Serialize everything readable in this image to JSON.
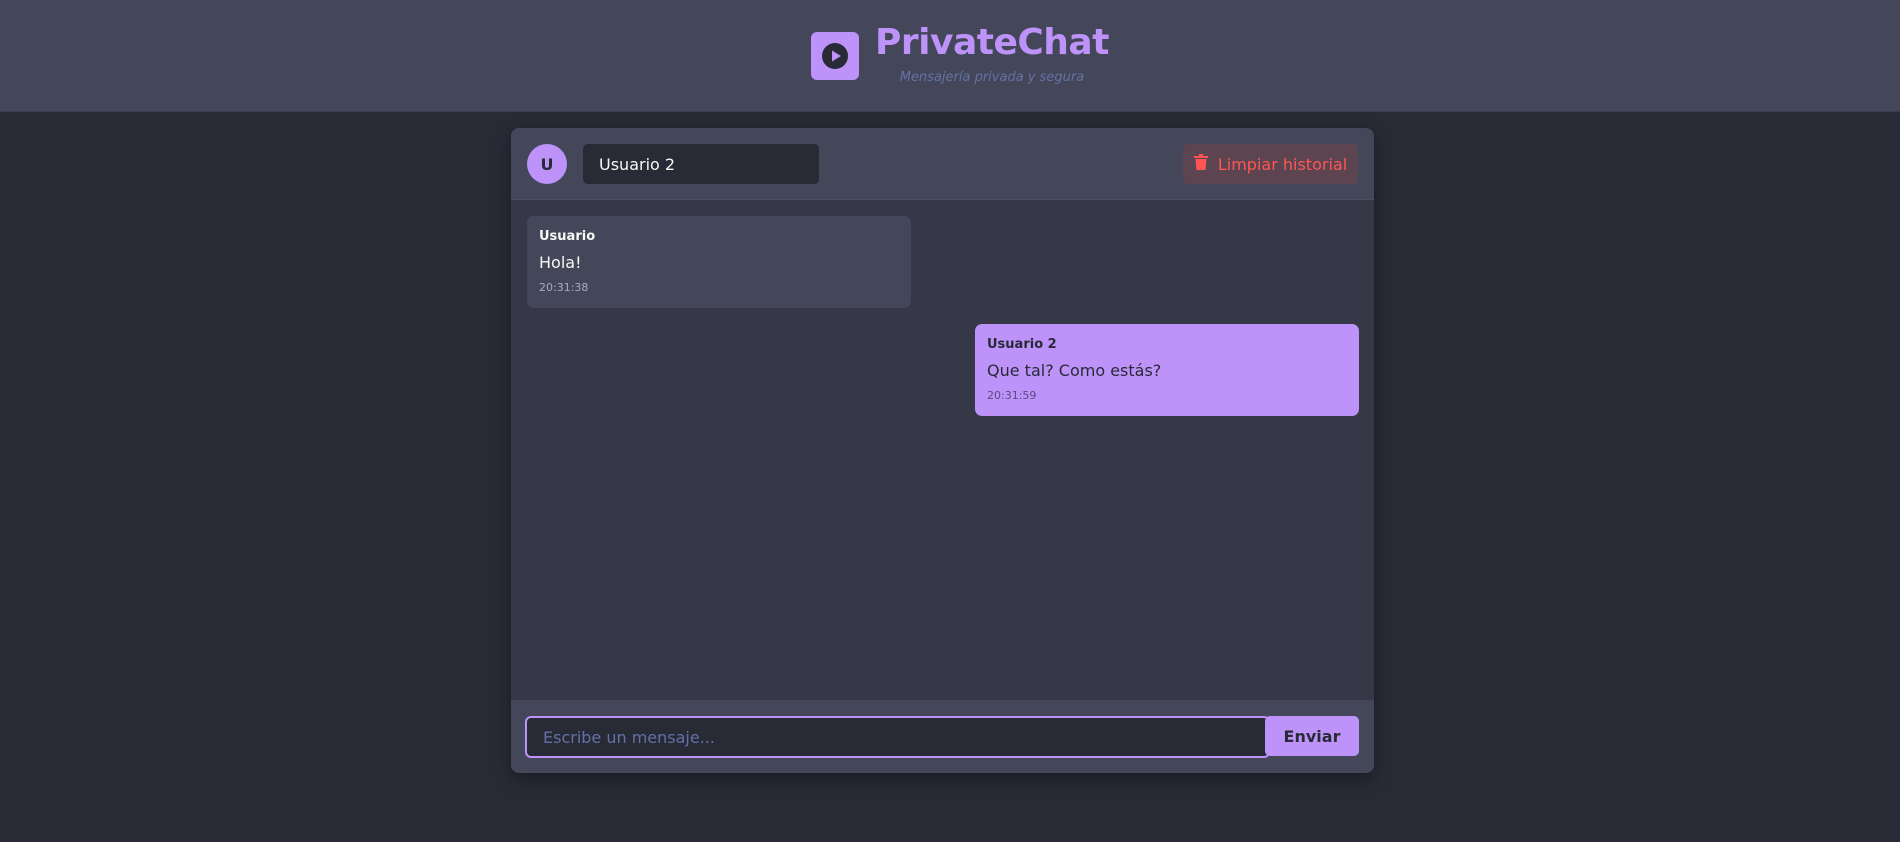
{
  "app": {
    "title": "PrivateChat",
    "subtitle": "Mensajería privada y segura",
    "logo_icon": "play-circle-icon"
  },
  "colors": {
    "accent": "#bd93f9",
    "background": "#282a36",
    "panel": "#44475a",
    "danger": "#ff5555",
    "muted": "#6272a4"
  },
  "chat_header": {
    "avatar_initial": "U",
    "username_value": "Usuario 2",
    "clear_label": "Limpiar historial",
    "clear_icon": "trash-icon"
  },
  "messages": [
    {
      "sender": "Usuario",
      "text": "Hola!",
      "time": "20:31:38",
      "direction": "received"
    },
    {
      "sender": "Usuario 2",
      "text": "Que tal? Como estás?",
      "time": "20:31:59",
      "direction": "sent"
    }
  ],
  "composer": {
    "placeholder": "Escribe un mensaje...",
    "value": "",
    "send_label": "Enviar"
  }
}
